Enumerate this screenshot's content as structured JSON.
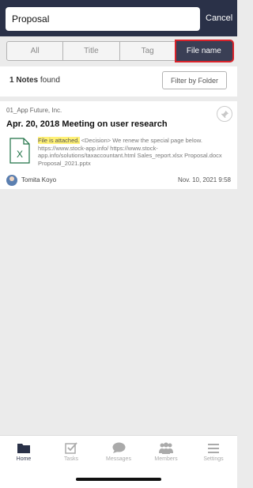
{
  "search": {
    "value": "Proposal",
    "cancel_label": "Cancel"
  },
  "segments": [
    {
      "label": "All",
      "active": false
    },
    {
      "label": "Title",
      "active": false
    },
    {
      "label": "Tag",
      "active": false
    },
    {
      "label": "File name",
      "active": true
    }
  ],
  "results": {
    "count": "1 Notes",
    "suffix": "found",
    "filter_label": "Filter by Folder"
  },
  "note": {
    "folder": "01_App Future, Inc.",
    "title": "Apr. 20, 2018 Meeting on user research",
    "snippet_highlight": "File is attached.",
    "snippet_rest": " <Decision> We renew the special page below. https://www.stock-app.info/ https://www.stock-app.info/solutions/taxaccountant.html    Sales_report.xlsx Proposal.docx  Proposal_2021.pptx",
    "author": "Tomita Koyo",
    "date": "Nov. 10, 2021 9:58",
    "file_icon": "excel-file-icon"
  },
  "tabs": [
    {
      "label": "Home",
      "icon": "folder-icon",
      "active": true
    },
    {
      "label": "Tasks",
      "icon": "checkbox-icon",
      "active": false
    },
    {
      "label": "Messages",
      "icon": "chat-bubble-icon",
      "active": false
    },
    {
      "label": "Members",
      "icon": "people-icon",
      "active": false
    },
    {
      "label": "Settings",
      "icon": "menu-icon",
      "active": false
    }
  ],
  "colors": {
    "header": "#2a3148",
    "active_segment": "#3a3f55",
    "highlight_box": "#d8222a",
    "excel_green": "#1e7145"
  }
}
